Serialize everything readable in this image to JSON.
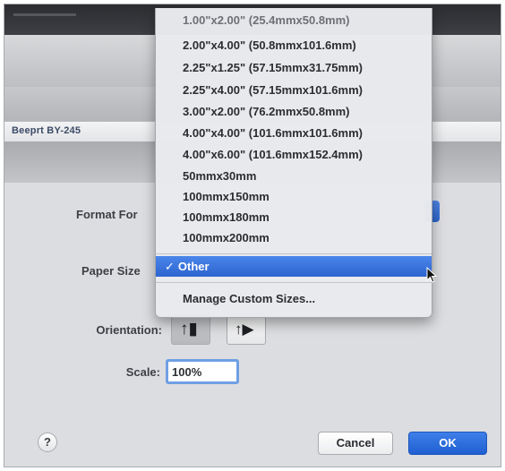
{
  "printer": {
    "name": "Beeprt BY-245"
  },
  "labels": {
    "format_for": "Format For",
    "paper_size": "Paper Size",
    "orientation": "Orientation:",
    "scale": "Scale:"
  },
  "paper_size_menu": {
    "items": [
      "1.00\"x2.00\" (25.4mmx50.8mm)",
      "2.00\"x4.00\" (50.8mmx101.6mm)",
      "2.25\"x1.25\" (57.15mmx31.75mm)",
      "2.25\"x4.00\" (57.15mmx101.6mm)",
      "3.00\"x2.00\" (76.2mmx50.8mm)",
      "4.00\"x4.00\" (101.6mmx101.6mm)",
      "4.00\"x6.00\" (101.6mmx152.4mm)",
      "50mmx30mm",
      "100mmx150mm",
      "100mmx180mm",
      "100mmx200mm"
    ],
    "selected": "Other",
    "check": "✓",
    "manage": "Manage Custom Sizes..."
  },
  "orientation": {
    "portrait_icon": "portrait-orientation-icon",
    "landscape_icon": "landscape-orientation-icon",
    "portrait_glyph": "↑▮",
    "landscape_glyph": "↑▶",
    "selected": "portrait"
  },
  "scale": {
    "value": "100%"
  },
  "buttons": {
    "help": "?",
    "cancel": "Cancel",
    "ok": "OK"
  },
  "colors": {
    "accent": "#2f6bd6",
    "menu_bg": "#e9eaed",
    "dialog_bg": "#dcdde0"
  }
}
